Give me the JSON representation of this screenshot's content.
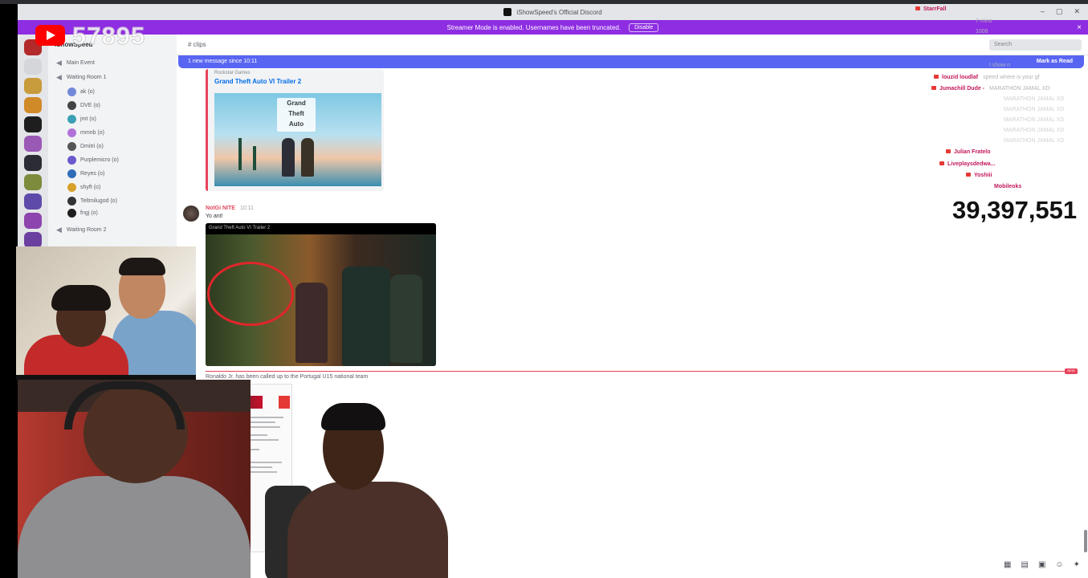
{
  "window": {
    "title": "iShowSpeed's Official Discord"
  },
  "banner": {
    "text": "Streamer Mode is enabled. Usernames have been truncated.",
    "disable_label": "Disable",
    "close_icon": "×"
  },
  "overlay": {
    "yt_count": "57895",
    "big_number": "39,397,551"
  },
  "sidebar": {
    "server_name": "iShowSpeed",
    "channels": [
      {
        "label": "Main Event"
      },
      {
        "label": "Waiting Room 1"
      },
      {
        "label": "Waiting Room 2"
      }
    ],
    "voice_users": [
      {
        "name": "ak (o)",
        "color": "#7289da"
      },
      {
        "name": "DVE (o)",
        "color": "#444444"
      },
      {
        "name": "jmt (o)",
        "color": "#3ba0b5"
      },
      {
        "name": "mmnb (o)",
        "color": "#b072d8"
      },
      {
        "name": "Dmitri (o)",
        "color": "#555555"
      },
      {
        "name": "Purplemicro (o)",
        "color": "#6a5acd"
      },
      {
        "name": "Reyes (o)",
        "color": "#2f6db8"
      },
      {
        "name": "shyft (o)",
        "color": "#d6a12a"
      },
      {
        "name": "Teltmilugod (o)",
        "color": "#333333"
      },
      {
        "name": "fngj (o)",
        "color": "#1e1e1e"
      }
    ]
  },
  "chat": {
    "channel": "clips",
    "search_placeholder": "Search",
    "new_messages": "1 new message since 10:11",
    "mark_as_read": "Mark as Read",
    "embed": {
      "provider": "Rockstar Games",
      "title": "Grand Theft Auto VI Trailer 2",
      "logo_lines": [
        "Grand",
        "Theft",
        "Auto"
      ]
    },
    "message": {
      "author": "NotGi NITE",
      "timestamp": "10:11",
      "text": "Yo ant!",
      "video_title": "Grand Theft Auto VI Trailer 2"
    },
    "new_tag": "NEW",
    "headline": "Ronaldo Jr. has been called up to the Portugal U15 national team"
  },
  "right_chat": {
    "top_names": [
      "StarrFall",
      "7 mins",
      "1008"
    ],
    "lines": [
      {
        "name": "",
        "text": "I show n"
      },
      {
        "name": "louzid loudlaf",
        "text": "speed where is your gf"
      },
      {
        "name": "Jumachill Dude -",
        "text": "MARATHON JAMAL XD"
      },
      {
        "name": "Julian Fratelo",
        "text": ""
      },
      {
        "name": "Liveplaysdedwa...",
        "text": ""
      },
      {
        "name": "Yoshiii",
        "text": ""
      },
      {
        "name": "Mobileoks",
        "text": ""
      }
    ],
    "spam_lines": [
      "MARATHON JAMAL XD",
      "MARATHON JAMAL XD",
      "MARATHON JAMAL XD",
      "MARATHON JAMAL XD",
      "MARATHON JAMAL XD"
    ]
  },
  "colors": {
    "banner": "#8e2de2",
    "blurple": "#5865f2",
    "new_red": "#e8425a"
  }
}
